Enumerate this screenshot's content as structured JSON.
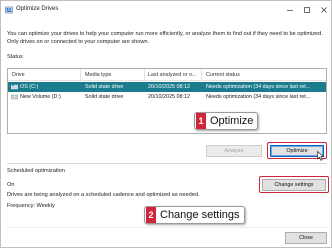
{
  "window": {
    "title": "Optimize Drives"
  },
  "intro_text": "You can optimize your drives to help your computer run more efficiently, or analyze them to find out if they need to be optimized. Only drives on or connected to your computer are shown.",
  "status_label": "Status",
  "table": {
    "headers": [
      "Drive",
      "Media type",
      "Last analyzed or o...",
      "Current status"
    ],
    "rows": [
      {
        "drive": "OS (C:)",
        "media": "Solid state drive",
        "last": "20/10/2025 08:12",
        "status": "Needs optimization (34 days since last ret...",
        "selected": true
      },
      {
        "drive": "New Volume (D:)",
        "media": "Solid state drive",
        "last": "20/10/2025 08:12",
        "status": "Needs optimization (34 days since last ret...",
        "selected": false
      }
    ]
  },
  "buttons": {
    "analyze": "Analyze",
    "optimize": "Optimize",
    "change_settings": "Change settings",
    "close": "Close"
  },
  "scheduled": {
    "title": "Scheduled optimization",
    "state": "On",
    "description": "Drives are being analyzed on a scheduled cadence and optimized as needed.",
    "frequency": "Frequency: Weekly"
  },
  "callouts": [
    {
      "number": "1",
      "label": "Optimize"
    },
    {
      "number": "2",
      "label": "Change settings"
    }
  ],
  "colors": {
    "selected_row": "#1b7c8d",
    "callout_red": "#d0253a",
    "focus_blue": "#0a64c8"
  }
}
